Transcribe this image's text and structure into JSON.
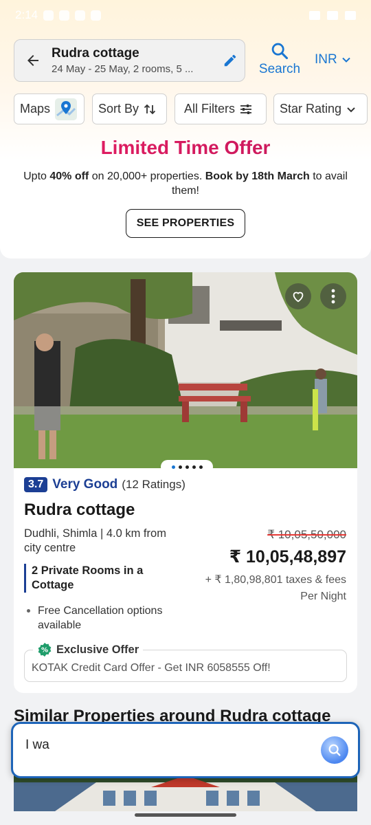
{
  "status_bar": {
    "time": "2:14"
  },
  "header": {
    "title": "Rudra cottage",
    "subtitle": "24 May - 25 May, 2 rooms, 5 ...",
    "search_label": "Search",
    "currency": "INR"
  },
  "filters": [
    {
      "label": "Maps"
    },
    {
      "label": "Sort By"
    },
    {
      "label": "All Filters"
    },
    {
      "label": "Star Rating"
    }
  ],
  "offer": {
    "title": "Limited Time Offer",
    "line_pre": "Upto ",
    "discount": "40% off",
    "line_mid": " on 20,000+ properties. ",
    "book_by": "Book by 18th March",
    "line_post": " to avail them!",
    "button": "SEE PROPERTIES"
  },
  "property": {
    "rating": "3.7",
    "rating_word": "Very Good",
    "rating_count": "(12 Ratings)",
    "name": "Rudra cottage",
    "location": "Dudhli, Shimla | 4.0 km from city centre",
    "rooms": "2 Private Rooms in a Cottage",
    "cancellation": "Free Cancellation options available",
    "old_price": "₹ 10,05,50,000",
    "price": "₹ 10,05,48,897",
    "taxes": "+ ₹ 1,80,98,801 taxes & fees",
    "per": "Per Night",
    "image_dots": 5,
    "active_dot": 0,
    "exclusive_label": "Exclusive Offer",
    "exclusive_text": "KOTAK Credit Card Offer - Get INR 6058555 Off!"
  },
  "similar": {
    "title": "Similar Properties around Rudra cottage"
  },
  "chat": {
    "text": "I wa"
  },
  "colors": {
    "accent_blue": "#1976d2",
    "rating_navy": "#1c3f94",
    "offer_pink": "#d81b60"
  }
}
